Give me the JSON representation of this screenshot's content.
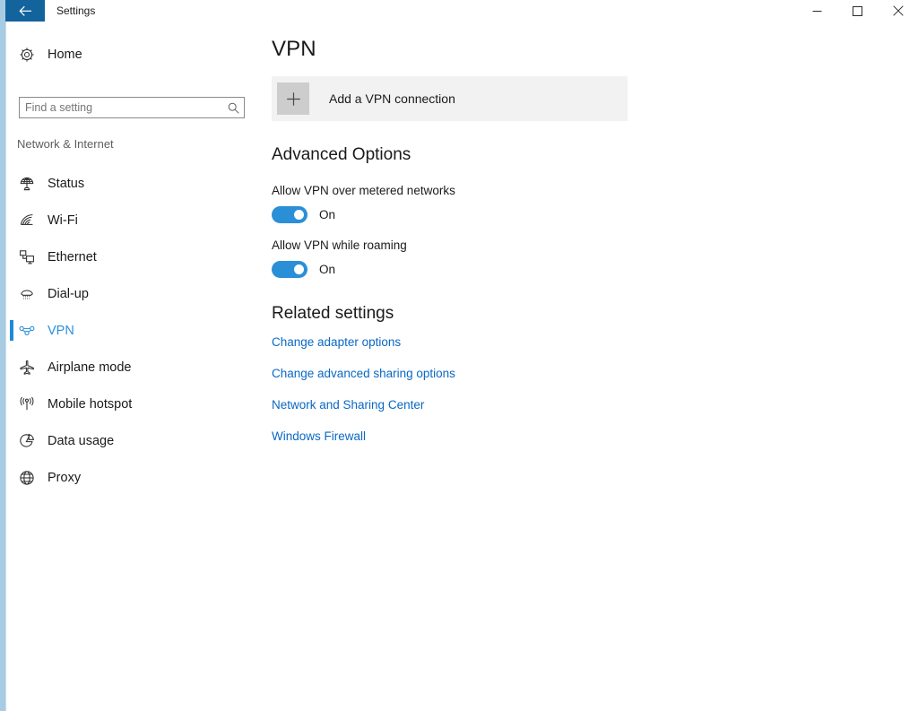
{
  "window": {
    "title": "Settings",
    "back_icon": "back-arrow-icon",
    "controls": {
      "minimize": "minimize-icon",
      "maximize": "maximize-icon",
      "close": "close-icon"
    }
  },
  "sidebar": {
    "home": {
      "label": "Home",
      "icon": "gear-icon"
    },
    "search": {
      "placeholder": "Find a setting",
      "value": "",
      "icon": "search-icon"
    },
    "category": "Network & Internet",
    "items": [
      {
        "label": "Status",
        "icon": "globe-status-icon",
        "selected": false
      },
      {
        "label": "Wi-Fi",
        "icon": "wifi-icon",
        "selected": false
      },
      {
        "label": "Ethernet",
        "icon": "ethernet-icon",
        "selected": false
      },
      {
        "label": "Dial-up",
        "icon": "dialup-phone-icon",
        "selected": false
      },
      {
        "label": "VPN",
        "icon": "vpn-icon",
        "selected": true
      },
      {
        "label": "Airplane mode",
        "icon": "airplane-icon",
        "selected": false
      },
      {
        "label": "Mobile hotspot",
        "icon": "hotspot-icon",
        "selected": false
      },
      {
        "label": "Data usage",
        "icon": "pie-chart-icon",
        "selected": false
      },
      {
        "label": "Proxy",
        "icon": "globe-icon",
        "selected": false
      }
    ]
  },
  "main": {
    "title": "VPN",
    "add_connection": {
      "label": "Add a VPN connection",
      "icon": "plus-icon"
    },
    "advanced_options": {
      "heading": "Advanced Options",
      "settings": [
        {
          "label": "Allow VPN over metered networks",
          "state": "On",
          "value": true
        },
        {
          "label": "Allow VPN while roaming",
          "state": "On",
          "value": true
        }
      ]
    },
    "related_settings": {
      "heading": "Related settings",
      "links": [
        "Change adapter options",
        "Change advanced sharing options",
        "Network and Sharing Center",
        "Windows Firewall"
      ]
    }
  },
  "colors": {
    "accent": "#2b8fd8",
    "titlebar_back": "#13639d",
    "link": "#0a68c4",
    "tile_bg": "#f2f2f2"
  }
}
